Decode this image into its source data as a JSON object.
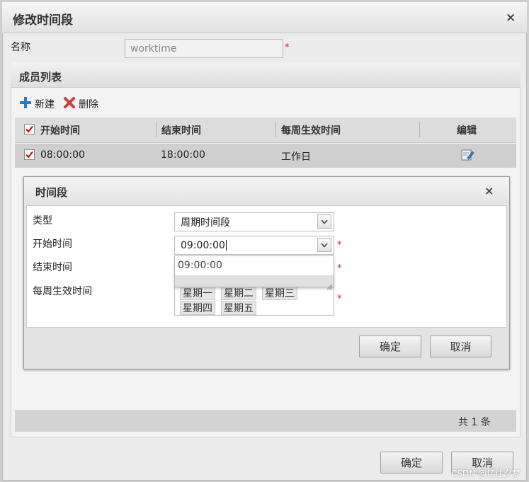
{
  "window": {
    "title": "修改时间段",
    "close": "×"
  },
  "form": {
    "name_label": "名称",
    "name_value": "worktime",
    "required_mark": "*"
  },
  "members": {
    "title": "成员列表",
    "toolbar": {
      "new_label": "新建",
      "delete_label": "删除"
    },
    "columns": [
      "开始时间",
      "结束时间",
      "每周生效时间",
      "编辑"
    ],
    "rows": [
      {
        "checked": true,
        "start": "08:00:00",
        "end": "18:00:00",
        "days": "工作日"
      }
    ],
    "footer": "共 1 条"
  },
  "dialog": {
    "title": "时间段",
    "close": "×",
    "type_label": "类型",
    "type_value": "周期时间段",
    "start_label": "开始时间",
    "start_value": "09:00:00",
    "end_label": "结束时间",
    "days_label": "每周生效时间",
    "dropdown_option": "09:00:00",
    "days_selected": [
      "星期一",
      "星期二",
      "星期三",
      "星期四",
      "星期五"
    ],
    "ok": "确定",
    "cancel": "取消"
  },
  "footer": {
    "ok": "确定",
    "cancel": "取消"
  },
  "watermark": "CSDN @忆往夕梦",
  "colors": {
    "required": "#e02020",
    "checkbox": "#cc1111",
    "add_icon": "#2b78c8",
    "delete_icon": "#d63a3a"
  }
}
